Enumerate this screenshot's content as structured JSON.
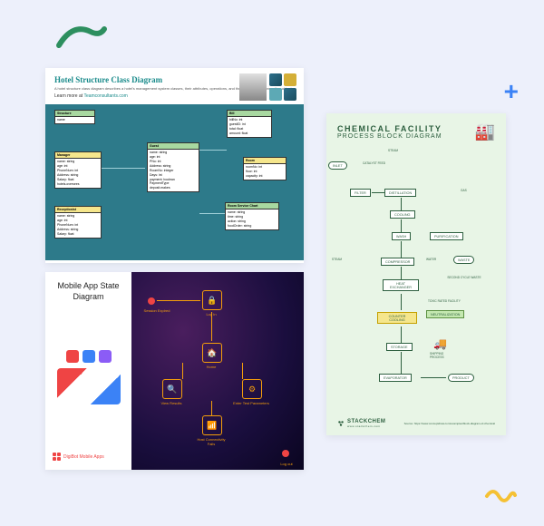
{
  "decorations": {
    "plus": "+"
  },
  "hotel": {
    "title": "Hotel Structure Class Diagram",
    "description": "A hotel structure class diagram describes a hotel's management system classes, their attributes, operations, and their relations by connecting objects.",
    "learn_prefix": "Learn more at ",
    "learn_link": "Teamconsultants.com",
    "boxes": {
      "structure": {
        "name": "Structure",
        "attrs": "name"
      },
      "manager": {
        "name": "Manager",
        "attrs": "name: string\nage: int\nPhoneNum: int\nAddress: string\nSalary: float\nhotels.oversees"
      },
      "reception": {
        "name": "Receptionist",
        "attrs": "name: string\nage: int\nPhoneNum: int\nAddress: string\nSalary: float"
      },
      "guest": {
        "name": "Guest",
        "attrs": "name: string\nage: int\nPNo: int\nAddress: string\nRoomNo: integer\nDays: int\npayment: boolean\nPaymentType\ndeposit.makes"
      },
      "bill": {
        "name": "Bill",
        "attrs": "billNo: int\nguestID: int\ntotal: float\namount: float"
      },
      "room": {
        "name": "Room",
        "attrs": "roomNo: int\nfloor: int\ncapacity: int"
      },
      "roomserv": {
        "name": "Room Service Chart",
        "attrs": "name: string\ntime: string\naction: string\nfoodOrder: string"
      }
    }
  },
  "mobile": {
    "title": "Mobile App State Diagram",
    "brand": "DigiBot Mobile Apps",
    "states": {
      "session_expired": "Session Expired",
      "login": "Log In",
      "home": "Home",
      "view_result": "View Results",
      "enter_test": "Enter Test Parameters",
      "wifi": "Host Connectivity Fails",
      "logout": "Log out"
    }
  },
  "chem": {
    "title1": "CHEMICAL FACILITY",
    "title2": "PROCESS BLOCK DIAGRAM",
    "brand": "STACKCHEM",
    "brand_url": "www.stackchem.com",
    "credit": "Source: https://www.conceptdraw.com/examples/block-diagram-of-chemical",
    "labels": {
      "steam": "STEAM",
      "catalyst_feed": "CATALYST FEED",
      "gas": "GAS",
      "water": "WATER",
      "toxic": "TOXIC RATED FACILITY",
      "shipping": "SHIPPING PROCESS"
    },
    "nodes": {
      "inlet": "INLET",
      "filter": "FILTER",
      "distillation": "DISTILLATION",
      "cooling": "COOLING",
      "wash": "WASH",
      "purification": "PURIFICATION",
      "compressor": "COMPRESSOR",
      "heat_exchanger": "HEAT EXCHANGER",
      "waste": "WASTE",
      "second_cycle": "SECOND CYCLE WASTE",
      "counter_cooling": "COUNTER COOLING",
      "neutralization": "NEUTRALIZATION",
      "storage": "STORAGE",
      "evaporator": "EVAPORATOR",
      "product": "PRODUCT"
    }
  }
}
